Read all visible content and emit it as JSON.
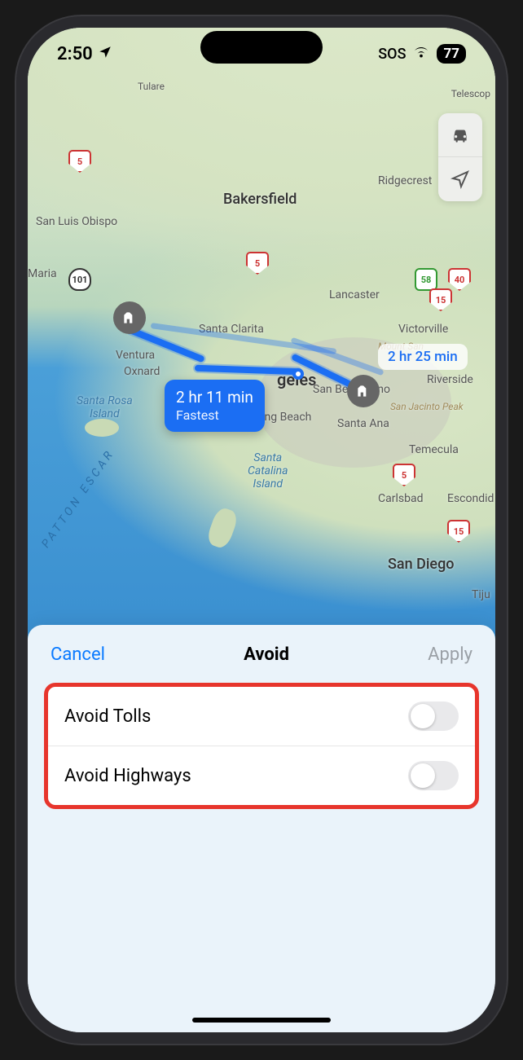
{
  "status": {
    "time": "2:50",
    "location_icon": "location-arrow",
    "sos": "SOS",
    "battery": "77"
  },
  "map": {
    "cities": {
      "tulare": "Tulare",
      "telescop": "Telescop",
      "bakersfield": "Bakersfield",
      "ridgecrest": "Ridgecrest",
      "san_luis_obispo": "San Luis Obispo",
      "maria": "Maria",
      "lancaster": "Lancaster",
      "santa_clarita": "Santa Clarita",
      "victorville": "Victorville",
      "ventura": "Ventura",
      "oxnard": "Oxnard",
      "los_angeles": "Los Angeles",
      "san_bernardino": "San Bernardino",
      "riverside": "Riverside",
      "long_beach": "Long Beach",
      "santa_ana": "Santa Ana",
      "temecula": "Temecula",
      "carlsbad": "Carlsbad",
      "escondido": "Escondid",
      "san_diego": "San Diego",
      "tijuana": "Tiju",
      "santa_rosa_island": "Santa Rosa\nIsland",
      "santa_catalina_island": "Santa\nCatalina\nIsland",
      "mount_san": "Mount San",
      "san_jacinto_peak": "San Jacinto Peak",
      "patton_escar": "PATTON ESCAR"
    },
    "shields": {
      "i5": "5",
      "i15": "15",
      "i40": "40",
      "us101": "101",
      "ca58": "58"
    },
    "route_main": {
      "time": "2 hr 11 min",
      "label": "Fastest"
    },
    "route_alt": {
      "time": "2 hr 25 min"
    }
  },
  "controls": {
    "mode_icon": "car",
    "locate_icon": "nav-arrow"
  },
  "sheet": {
    "cancel": "Cancel",
    "title": "Avoid",
    "apply": "Apply",
    "options": [
      {
        "label": "Avoid Tolls",
        "on": false
      },
      {
        "label": "Avoid Highways",
        "on": false
      }
    ]
  }
}
